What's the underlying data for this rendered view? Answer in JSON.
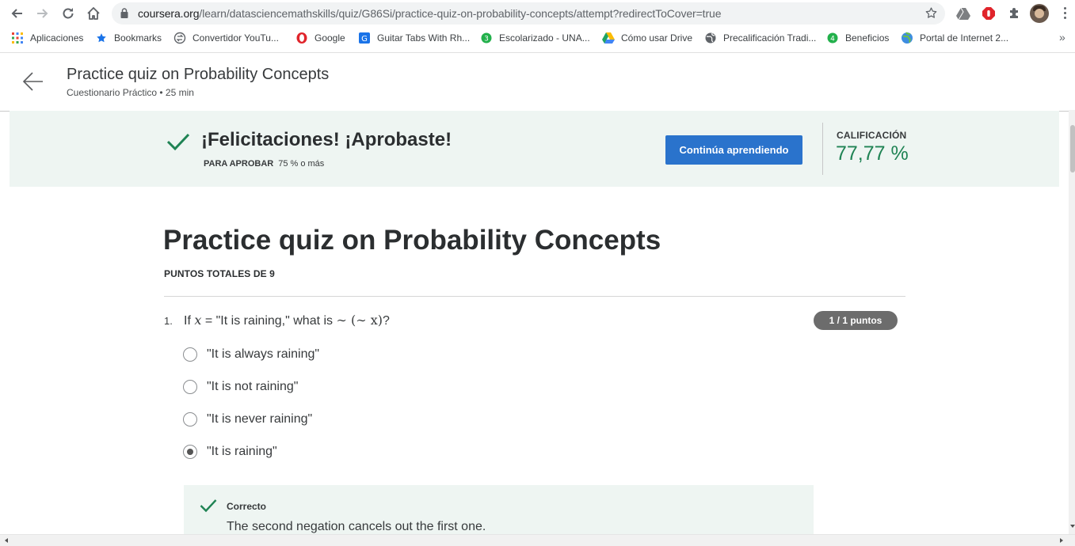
{
  "browser": {
    "url_host": "coursera.org",
    "url_path": "/learn/datasciencemathskills/quiz/G86Si/practice-quiz-on-probability-concepts/attempt?redirectToCover=true"
  },
  "bookmarks": {
    "items": [
      {
        "label": "Aplicaciones",
        "icon": "apps-grid-icon"
      },
      {
        "label": "Bookmarks",
        "icon": "star-icon"
      },
      {
        "label": "Convertidor YouTu...",
        "icon": "converter-icon"
      },
      {
        "label": "Google",
        "icon": "opera-icon"
      },
      {
        "label": "Guitar Tabs With Rh...",
        "icon": "guitar-tabs-icon"
      },
      {
        "label": "Escolarizado - UNA...",
        "icon": "green-badge-icon"
      },
      {
        "label": "Cómo usar Drive",
        "icon": "drive-icon"
      },
      {
        "label": "Precalificación Tradi...",
        "icon": "globe-icon"
      },
      {
        "label": "Beneficios",
        "icon": "green-badge-icon"
      },
      {
        "label": "Portal de Internet 2...",
        "icon": "earth-icon"
      }
    ],
    "more": "»"
  },
  "header": {
    "title": "Practice quiz on Probability Concepts",
    "subtitle": "Cuestionario Práctico • 25 min"
  },
  "banner": {
    "congrats": "¡Felicitaciones! ¡Aprobaste!",
    "pass_label": "PARA APROBAR",
    "pass_value": "75 % o más",
    "continue_button": "Continúa aprendiendo",
    "grade_label": "CALIFICACIÓN",
    "grade_value": "77,77 %"
  },
  "quiz": {
    "title": "Practice quiz on Probability Concepts",
    "total_points": "PUNTOS TOTALES DE 9",
    "questions": [
      {
        "number": "1.",
        "text_prefix": "If",
        "math_var": "x",
        "text_eq": "= \"It is raining,\" what is",
        "math_expr": "∼ (∼ x)",
        "text_suffix": "?",
        "points_badge": "1 / 1 puntos",
        "options": [
          {
            "label": "\"It is always raining\"",
            "selected": false
          },
          {
            "label": "\"It is not raining\"",
            "selected": false
          },
          {
            "label": "\"It is never raining\"",
            "selected": false
          },
          {
            "label": "\"It is raining\"",
            "selected": true
          }
        ],
        "feedback": {
          "status": "Correcto",
          "text": "The second negation cancels out the first one."
        }
      }
    ]
  },
  "colors": {
    "accent_blue": "#2a73cc",
    "success_green": "#1f8354",
    "banner_bg": "#eef5f2"
  }
}
